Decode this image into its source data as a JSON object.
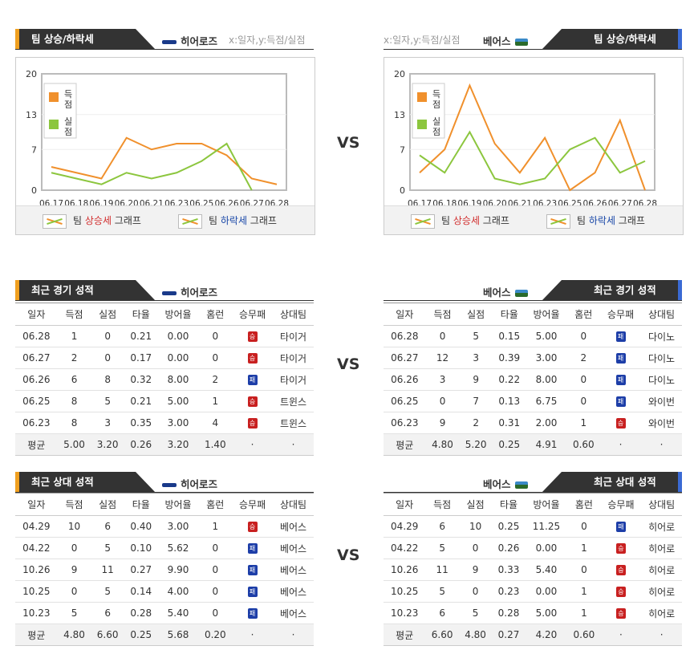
{
  "colors": {
    "score": "#f0902c",
    "allowed": "#8cc63e",
    "accent": "#f0a020",
    "win": "#c82020",
    "loss": "#1d3ea8"
  },
  "vs_label": "VS",
  "trend": {
    "title": "팀 상승/하락세",
    "axis_note": "x:일자,y:득점/실점",
    "legend": {
      "score": "득점",
      "allowed": "실점"
    },
    "footer": {
      "up_prefix": "팀 ",
      "up_word": "상승세",
      "up_suffix": " 그래프",
      "down_prefix": "팀 ",
      "down_word": "하락세",
      "down_suffix": " 그래프"
    }
  },
  "recent_title": "최근 경기 성적",
  "h2h_title": "최근 상대 성적",
  "columns": [
    "일자",
    "득점",
    "실점",
    "타율",
    "방어율",
    "홈런",
    "승무패",
    "상대팀"
  ],
  "avg_label": "평균",
  "teams": {
    "left": {
      "name": "히어로즈"
    },
    "right": {
      "name": "베어스"
    }
  },
  "chart_data": [
    {
      "type": "line",
      "title": "",
      "yticks": [
        0,
        7,
        13,
        20
      ],
      "ylim": [
        0,
        20
      ],
      "x": [
        "06.17",
        "06.18",
        "06.19",
        "06.20",
        "06.21",
        "06.23",
        "06.25",
        "06.26",
        "06.27",
        "06.28"
      ],
      "series": [
        {
          "name": "득점",
          "values": [
            4,
            3,
            2,
            9,
            7,
            8,
            8,
            6,
            2,
            1
          ]
        },
        {
          "name": "실점",
          "values": [
            3,
            2,
            1,
            3,
            2,
            3,
            5,
            8,
            0,
            null
          ]
        }
      ]
    },
    {
      "type": "line",
      "title": "",
      "yticks": [
        0,
        7,
        13,
        20
      ],
      "ylim": [
        0,
        20
      ],
      "x": [
        "06.17",
        "06.18",
        "06.19",
        "06.20",
        "06.21",
        "06.23",
        "06.25",
        "06.26",
        "06.27",
        "06.28"
      ],
      "series": [
        {
          "name": "득점",
          "values": [
            3,
            7,
            18,
            8,
            3,
            9,
            0,
            3,
            12,
            0
          ]
        },
        {
          "name": "실점",
          "values": [
            6,
            3,
            10,
            2,
            1,
            2,
            7,
            9,
            3,
            5
          ]
        }
      ]
    }
  ],
  "recent": {
    "left": {
      "rows": [
        [
          "06.28",
          "1",
          "0",
          "0.21",
          "0.00",
          "0",
          "W",
          "타이거"
        ],
        [
          "06.27",
          "2",
          "0",
          "0.17",
          "0.00",
          "0",
          "W",
          "타이거"
        ],
        [
          "06.26",
          "6",
          "8",
          "0.32",
          "8.00",
          "2",
          "L",
          "타이거"
        ],
        [
          "06.25",
          "8",
          "5",
          "0.21",
          "5.00",
          "1",
          "W",
          "트윈스"
        ],
        [
          "06.23",
          "8",
          "3",
          "0.35",
          "3.00",
          "4",
          "W",
          "트윈스"
        ]
      ],
      "avg": [
        "5.00",
        "3.20",
        "0.26",
        "3.20",
        "1.40",
        "·",
        "·"
      ]
    },
    "right": {
      "rows": [
        [
          "06.28",
          "0",
          "5",
          "0.15",
          "5.00",
          "0",
          "L",
          "다이노"
        ],
        [
          "06.27",
          "12",
          "3",
          "0.39",
          "3.00",
          "2",
          "L",
          "다이노"
        ],
        [
          "06.26",
          "3",
          "9",
          "0.22",
          "8.00",
          "0",
          "L",
          "다이노"
        ],
        [
          "06.25",
          "0",
          "7",
          "0.13",
          "6.75",
          "0",
          "L",
          "와이번"
        ],
        [
          "06.23",
          "9",
          "2",
          "0.31",
          "2.00",
          "1",
          "W",
          "와이번"
        ]
      ],
      "avg": [
        "4.80",
        "5.20",
        "0.25",
        "4.91",
        "0.60",
        "·",
        "·"
      ]
    }
  },
  "h2h": {
    "left": {
      "rows": [
        [
          "04.29",
          "10",
          "6",
          "0.40",
          "3.00",
          "1",
          "W",
          "베어스"
        ],
        [
          "04.22",
          "0",
          "5",
          "0.10",
          "5.62",
          "0",
          "L",
          "베어스"
        ],
        [
          "10.26",
          "9",
          "11",
          "0.27",
          "9.90",
          "0",
          "L",
          "베어스"
        ],
        [
          "10.25",
          "0",
          "5",
          "0.14",
          "4.00",
          "0",
          "L",
          "베어스"
        ],
        [
          "10.23",
          "5",
          "6",
          "0.28",
          "5.40",
          "0",
          "L",
          "베어스"
        ]
      ],
      "avg": [
        "4.80",
        "6.60",
        "0.25",
        "5.68",
        "0.20",
        "·",
        "·"
      ]
    },
    "right": {
      "rows": [
        [
          "04.29",
          "6",
          "10",
          "0.25",
          "11.25",
          "0",
          "L",
          "히어로"
        ],
        [
          "04.22",
          "5",
          "0",
          "0.26",
          "0.00",
          "1",
          "W",
          "히어로"
        ],
        [
          "10.26",
          "11",
          "9",
          "0.33",
          "5.40",
          "0",
          "W",
          "히어로"
        ],
        [
          "10.25",
          "5",
          "0",
          "0.23",
          "0.00",
          "1",
          "W",
          "히어로"
        ],
        [
          "10.23",
          "6",
          "5",
          "0.28",
          "5.00",
          "1",
          "W",
          "히어로"
        ]
      ],
      "avg": [
        "6.60",
        "4.80",
        "0.27",
        "4.20",
        "0.60",
        "·",
        "·"
      ]
    }
  },
  "result_glyph": {
    "W": "승",
    "L": "패"
  }
}
